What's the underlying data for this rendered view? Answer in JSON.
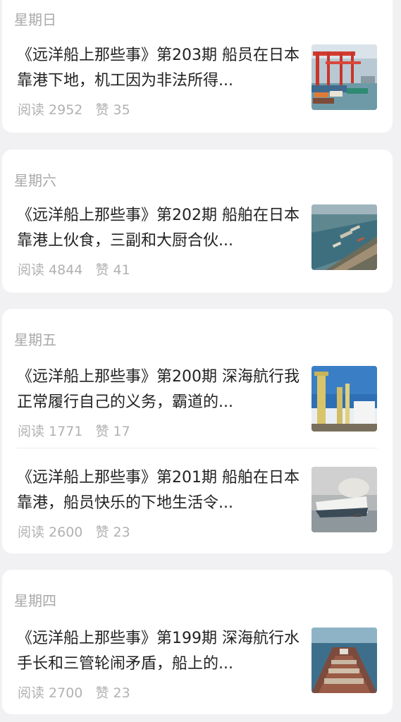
{
  "groups": [
    {
      "day": "星期日",
      "articles": [
        {
          "title": "《远洋船上那些事》第203期 船员在日本靠港下地，机工因为非法所得...",
          "read": "阅读 2952",
          "like": "赞 35",
          "thumbnail": "port-cranes-image"
        }
      ]
    },
    {
      "day": "星期六",
      "articles": [
        {
          "title": "《远洋船上那些事》第202期 船舶在日本靠港上伙食，三副和大厨合伙...",
          "read": "阅读 4844",
          "like": "赞 41",
          "thumbnail": "harbor-aerial-image"
        }
      ]
    },
    {
      "day": "星期五",
      "articles": [
        {
          "title": "《远洋船上那些事》第200期 深海航行我正常履行自己的义务，霸道的...",
          "read": "阅读 1771",
          "like": "赞 17",
          "thumbnail": "ship-crane-deck-image"
        },
        {
          "title": "《远洋船上那些事》第201期 船舶在日本靠港，船员快乐的下地生活令...",
          "read": "阅读 2600",
          "like": "赞 23",
          "thumbnail": "car-carrier-ship-image"
        }
      ]
    },
    {
      "day": "星期四",
      "articles": [
        {
          "title": "《远洋船上那些事》第199期 深海航行水手长和三管轮闹矛盾，船上的...",
          "read": "阅读 2700",
          "like": "赞 23",
          "thumbnail": "bulk-carrier-deck-image"
        }
      ]
    }
  ]
}
